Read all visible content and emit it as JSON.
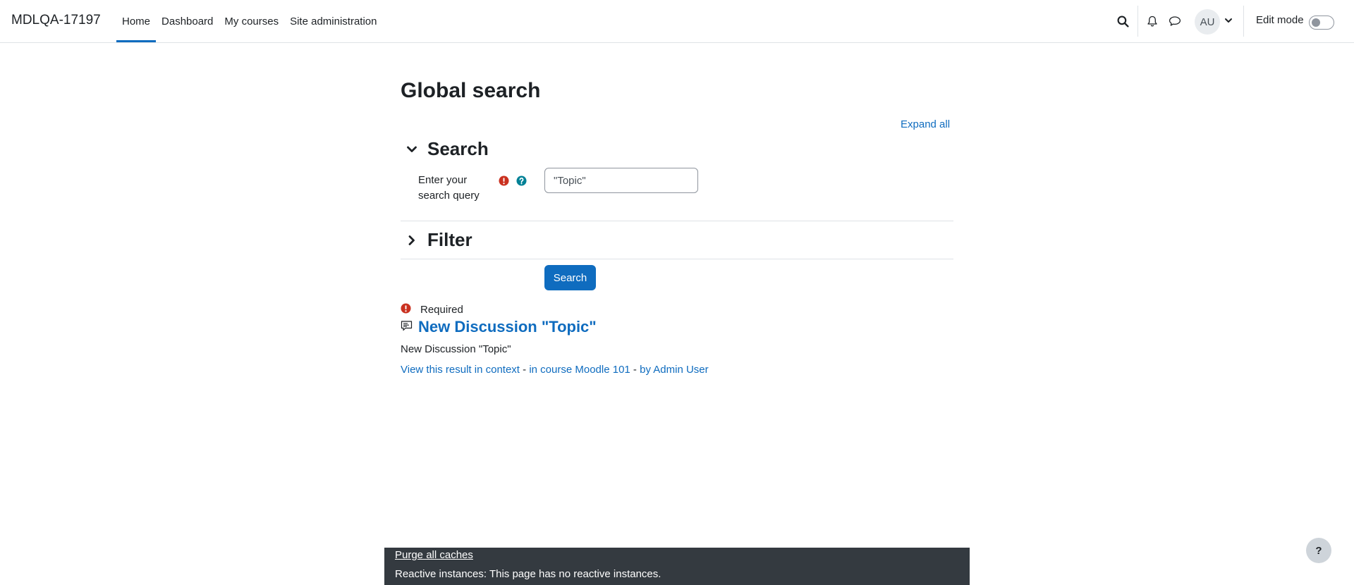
{
  "header": {
    "brand": "MDLQA-17197",
    "nav": [
      "Home",
      "Dashboard",
      "My courses",
      "Site administration"
    ],
    "avatar_initials": "AU",
    "edit_mode_label": "Edit mode"
  },
  "main": {
    "title": "Global search",
    "expand_all": "Expand all",
    "search_section": {
      "title": "Search",
      "query_label": "Enter your search query",
      "query_value": "\"Topic\""
    },
    "filter_section": {
      "title": "Filter"
    },
    "search_button": "Search",
    "required_text": "Required",
    "result": {
      "title": "New Discussion \"Topic\"",
      "description": "New Discussion \"Topic\"",
      "link_context": "View this result in context",
      "link_course": "in course Moodle 101",
      "link_author": "by Admin User",
      "separator": " - "
    }
  },
  "footer": {
    "purge": "Purge all caches",
    "reactive": "Reactive instances: This page has no reactive instances."
  },
  "help_fab": "?",
  "colors": {
    "accent": "#0f6cbf",
    "danger": "#ca3120",
    "info": "#008196",
    "footer_bg": "#343a40"
  }
}
